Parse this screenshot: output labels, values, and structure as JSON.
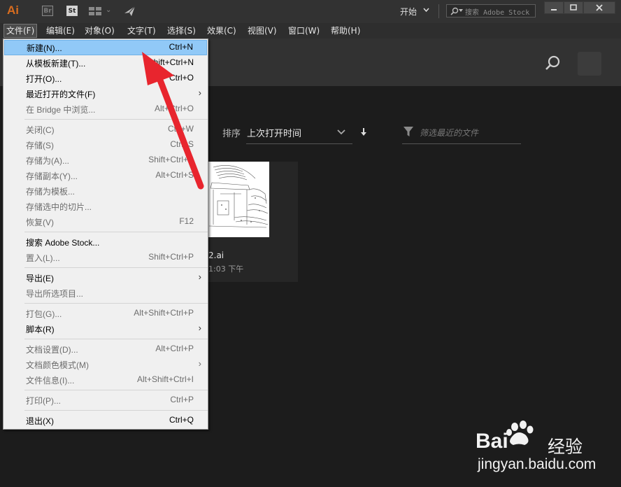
{
  "app": {
    "logo": "Ai",
    "bridge_label": "Br",
    "stock_label": "St",
    "workspace": "开始",
    "stock_search_placeholder": "搜索 Adobe Stock"
  },
  "menubar": {
    "items": [
      "文件(F)",
      "编辑(E)",
      "对象(O)",
      "文字(T)",
      "选择(S)",
      "效果(C)",
      "视图(V)",
      "窗口(W)",
      "帮助(H)"
    ],
    "active_index": 0
  },
  "file_menu": {
    "items": [
      {
        "label": "新建(N)...",
        "shortcut": "Ctrl+N",
        "enabled": true,
        "highlighted": true,
        "submenu": false
      },
      {
        "label": "从模板新建(T)...",
        "shortcut": "Shift+Ctrl+N",
        "enabled": true,
        "submenu": false
      },
      {
        "label": "打开(O)...",
        "shortcut": "Ctrl+O",
        "enabled": true,
        "submenu": false
      },
      {
        "label": "最近打开的文件(F)",
        "shortcut": "",
        "enabled": true,
        "submenu": true
      },
      {
        "label": "在 Bridge 中浏览...",
        "shortcut": "Alt+Ctrl+O",
        "enabled": false,
        "submenu": false
      },
      {
        "label": "关闭(C)",
        "shortcut": "Ctrl+W",
        "enabled": false,
        "submenu": false
      },
      {
        "label": "存储(S)",
        "shortcut": "Ctrl+S",
        "enabled": false,
        "submenu": false
      },
      {
        "label": "存储为(A)...",
        "shortcut": "Shift+Ctrl+S",
        "enabled": false,
        "submenu": false
      },
      {
        "label": "存储副本(Y)...",
        "shortcut": "Alt+Ctrl+S",
        "enabled": false,
        "submenu": false
      },
      {
        "label": "存储为模板...",
        "shortcut": "",
        "enabled": false,
        "submenu": false
      },
      {
        "label": "存储选中的切片...",
        "shortcut": "",
        "enabled": false,
        "submenu": false
      },
      {
        "label": "恢复(V)",
        "shortcut": "F12",
        "enabled": false,
        "submenu": false
      },
      {
        "label": "搜索 Adobe Stock...",
        "shortcut": "",
        "enabled": true,
        "submenu": false
      },
      {
        "label": "置入(L)...",
        "shortcut": "Shift+Ctrl+P",
        "enabled": false,
        "submenu": false
      },
      {
        "label": "导出(E)",
        "shortcut": "",
        "enabled": true,
        "submenu": true
      },
      {
        "label": "导出所选项目...",
        "shortcut": "",
        "enabled": false,
        "submenu": false
      },
      {
        "label": "打包(G)...",
        "shortcut": "Alt+Shift+Ctrl+P",
        "enabled": false,
        "submenu": false
      },
      {
        "label": "脚本(R)",
        "shortcut": "",
        "enabled": true,
        "submenu": true
      },
      {
        "label": "文档设置(D)...",
        "shortcut": "Alt+Ctrl+P",
        "enabled": false,
        "submenu": false
      },
      {
        "label": "文档颜色模式(M)",
        "shortcut": "",
        "enabled": false,
        "submenu": true
      },
      {
        "label": "文件信息(I)...",
        "shortcut": "Alt+Shift+Ctrl+I",
        "enabled": false,
        "submenu": false
      },
      {
        "label": "打印(P)...",
        "shortcut": "Ctrl+P",
        "enabled": false,
        "submenu": false
      },
      {
        "label": "退出(X)",
        "shortcut": "Ctrl+Q",
        "enabled": true,
        "submenu": false
      }
    ]
  },
  "start_screen": {
    "sort_label": "排序",
    "sort_value": "上次打开时间",
    "filter_placeholder": "筛选最近的文件",
    "recent_file": {
      "name": "2.ai",
      "time": "1:03 下午"
    }
  },
  "watermark": {
    "brand": "Bai",
    "brand_cn": "经验",
    "url": "jingyan.baidu.com"
  },
  "colors": {
    "highlight": "#91c9f7",
    "arrow": "#e8252e",
    "ai_orange": "#d86d1f"
  }
}
